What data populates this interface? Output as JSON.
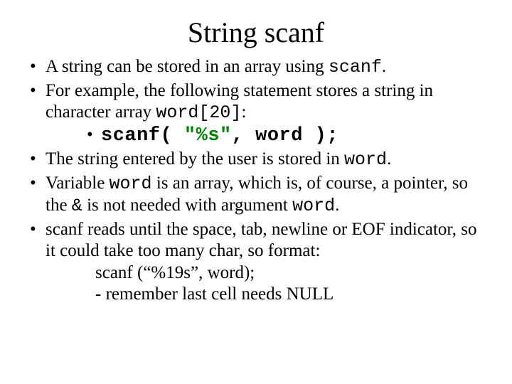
{
  "title": "String scanf",
  "b1_a": "A string can be stored in an array using ",
  "b1_code": "scanf",
  "b1_b": ".",
  "b2_a": "For example, the following statement stores a string in character array ",
  "b2_code": "word[20]",
  "b2_b": ":",
  "code_a": "scanf( ",
  "code_fmt": "\"%s\"",
  "code_b": ", word );",
  "b3_a": "The string entered by the user is stored in ",
  "b3_code": "word",
  "b3_b": ".",
  "b4_a": "Variable ",
  "b4_code1": "word",
  "b4_b": " is an array, which is, of course, a pointer, so the ",
  "b4_code2": "&",
  "b4_c": " is not needed with argument ",
  "b4_code3": "word",
  "b4_d": ".",
  "b5": "scanf reads until the space, tab, newline or EOF indicator, so it could take too many char, so format:",
  "b5_line1": "scanf (“%19s”, word);",
  "b5_line2": "- remember last cell needs NULL"
}
